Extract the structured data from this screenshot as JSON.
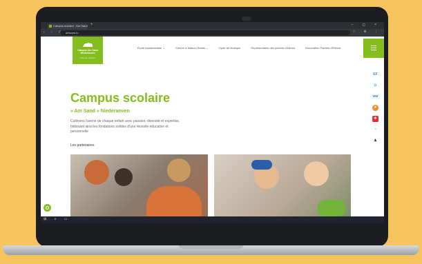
{
  "browser": {
    "tab_title": "Campus scolaire · Am Sand",
    "tab_close": "×",
    "new_tab": "+",
    "url": "amsand.lu",
    "nav_glyphs": "‹ › ⟳",
    "ext_glyphs": "☆ ⊕ ⋮",
    "window_glyphs": "– ◻ ×"
  },
  "site": {
    "logo_text": "Campus Am Sand Niederanven",
    "logo_sub": "Campus scolaire",
    "nav": [
      "École fondamentale ⌄",
      "Crèche & Maison Relais ⌄",
      "Cycle de Musique",
      "Représentants des parents d'élèves",
      "Association Parents d'Élèves"
    ],
    "hero_title": "Campus scolaire",
    "hero_subtitle": "« Am Sand » Niederanven",
    "hero_desc": "Cultivons l'avenir de chaque enfant avec passion, diversité et expertise, bâtissant ainsi les fondations solides d'une réussite éducative et personnelle",
    "partners_label": "Les partenaires"
  },
  "side_icons": [
    {
      "name": "ef-icon",
      "glyph": "EF",
      "color": "#3b8de0"
    },
    {
      "name": "leaf-icon",
      "glyph": "✿",
      "color": "#68c1e8"
    },
    {
      "name": "ww-icon",
      "glyph": "ww",
      "color": "#2a86d8"
    },
    {
      "name": "sun-icon",
      "glyph": "☀",
      "color": "#f08b2d"
    },
    {
      "name": "cross-icon",
      "glyph": "✚",
      "color": "#e03131"
    },
    {
      "name": "pie-icon",
      "glyph": "◔",
      "color": "#d6336c"
    },
    {
      "name": "person-icon",
      "glyph": "♟",
      "color": "#333333"
    }
  ],
  "taskbar": {
    "glyphs": "⊞ ⌕ ▭"
  },
  "colors": {
    "brand_green": "#84bd1e",
    "background": "#f5c45e"
  }
}
